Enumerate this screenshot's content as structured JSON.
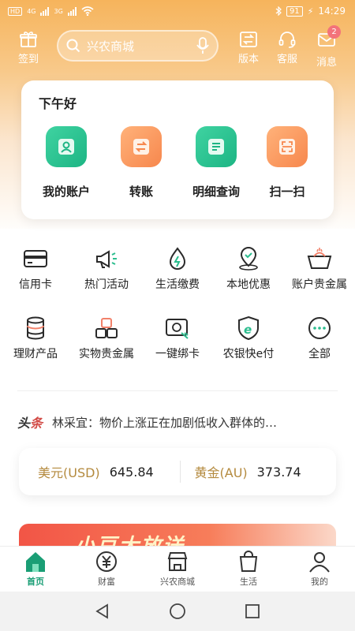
{
  "status_bar": {
    "left_tag": "HD",
    "net1": "4G",
    "net2": "3G",
    "battery": "91",
    "time": "14:29"
  },
  "header": {
    "signin_label": "签到",
    "search_placeholder": "兴农商城",
    "version_label": "版本",
    "service_label": "客服",
    "messages_label": "消息",
    "messages_badge": "2"
  },
  "card": {
    "greeting": "下午好",
    "actions": [
      {
        "label": "我的账户",
        "icon": "person-icon",
        "color": "green"
      },
      {
        "label": "转账",
        "icon": "transfer-icon",
        "color": "orange"
      },
      {
        "label": "明细查询",
        "icon": "list-icon",
        "color": "green"
      },
      {
        "label": "扫一扫",
        "icon": "scan-icon",
        "color": "orange"
      }
    ]
  },
  "services": [
    {
      "label": "信用卡",
      "icon": "credit-card-icon"
    },
    {
      "label": "热门活动",
      "icon": "megaphone-icon"
    },
    {
      "label": "生活缴费",
      "icon": "energy-drop-icon"
    },
    {
      "label": "本地优惠",
      "icon": "location-icon"
    },
    {
      "label": "账户贵金属",
      "icon": "gold-basket-icon"
    },
    {
      "label": "理财产品",
      "icon": "coins-stack-icon"
    },
    {
      "label": "实物贵金属",
      "icon": "gold-bars-icon"
    },
    {
      "label": "一键绑卡",
      "icon": "bind-card-icon"
    },
    {
      "label": "农银快e付",
      "icon": "e-pay-shield-icon"
    },
    {
      "label": "全部",
      "icon": "more-icon"
    }
  ],
  "headline": {
    "tag_a": "头",
    "tag_b": "条",
    "text": "林采宜：物价上涨正在加剧低收入群体的…"
  },
  "rates": [
    {
      "name": "美元(USD)",
      "value": "645.84"
    },
    {
      "name": "黄金(AU)",
      "value": "373.74"
    }
  ],
  "banner": {
    "title": "小豆大放送"
  },
  "tabbar": [
    {
      "label": "首页",
      "icon": "home-icon",
      "active": true
    },
    {
      "label": "财富",
      "icon": "yen-icon",
      "active": false
    },
    {
      "label": "兴农商城",
      "icon": "store-icon",
      "active": false
    },
    {
      "label": "生活",
      "icon": "shopping-bag-icon",
      "active": false
    },
    {
      "label": "我的",
      "icon": "user-icon",
      "active": false
    }
  ],
  "colors": {
    "accent_green": "#1a9e75",
    "header_orange": "#f6b45c",
    "headline_red": "#d24a45",
    "rate_gold": "#b48a3e"
  }
}
